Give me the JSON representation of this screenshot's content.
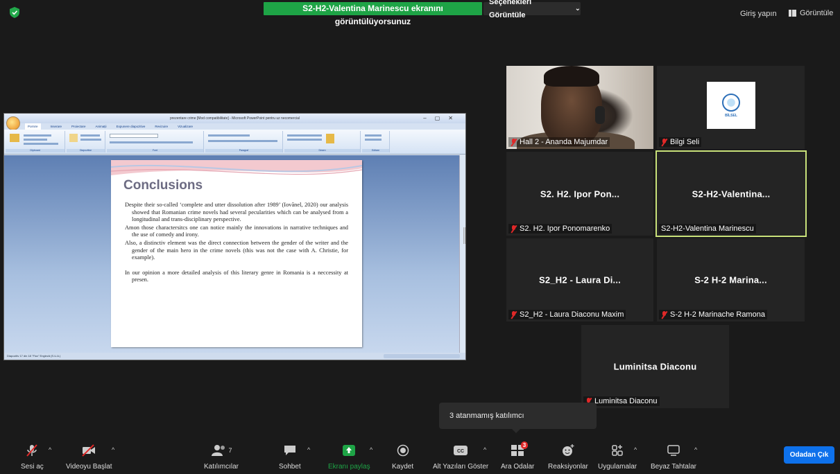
{
  "top": {
    "share_banner": "S2-H2-Valentina Marinescu ekranını görüntülüyorsunuz",
    "view_options": "Seçenekleri Görüntüle",
    "signin": "Giriş yapın",
    "view": "Görüntüle"
  },
  "ppt": {
    "window_title": "prezentare crime [Mod compatibilitate] - Microsoft PowerPoint pentru uz necomercial",
    "tabs": [
      "Pornire",
      "Inserare",
      "Proiectare",
      "Animații",
      "Expunere diapozitive",
      "Revizuire",
      "Vizualizare"
    ],
    "groups": [
      "Clipboard",
      "Diapozitive",
      "Font",
      "Paragraf",
      "Desen",
      "Editare"
    ],
    "status": "Diapozitiv 17 din 18   \"Flux\"   Engleză (S.U.A.)",
    "slide": {
      "title": "Conclusions",
      "paragraphs": [
        "Despite their so-called ‘complete and utter dissolution after 1989’ (Iovănel, 2020) our analysis showed that Romanian crime novels had several pecularities which can be analysed from a longitudinal and trans-disciplinary perspective.",
        "Amon those charactersitcs one can notice mainly the innovations in narrative techniques and the use of comedy and irony.",
        "Also, a distinctiv element was the direct connection between the gender of the writer and the gender of the main hero in the crime novels (this was not the case with A. Christie, for example).",
        "In our opinion a more detailed analysis of this literary genre in Romania is a neccessity at presen."
      ]
    }
  },
  "participants": [
    {
      "label": "Hall 2 - Ananda Majumdar",
      "muted": true,
      "kind": "video"
    },
    {
      "label": "Bilgi Seli",
      "muted": true,
      "kind": "logo",
      "logo_text": "BİLSEL"
    },
    {
      "center": "S2. H2. Ipor Pon...",
      "label": "S2. H2. Ipor Ponomarenko",
      "muted": true
    },
    {
      "center": "S2-H2-Valentina...",
      "label": "S2-H2-Valentina Marinescu",
      "muted": false,
      "active": true
    },
    {
      "center": "S2_H2 - Laura Di...",
      "label": "S2_H2 - Laura Diaconu Maxim",
      "muted": true
    },
    {
      "center": "S-2 H-2   Marina...",
      "label": "S-2 H-2   Marinache Ramona",
      "muted": true
    },
    {
      "center": "Luminitsa Diaconu",
      "label": "Luminitsa Diaconu",
      "muted": true
    }
  ],
  "tooltip": "3 atanmamış katılımcı",
  "toolbar": {
    "unmute": "Sesi aç",
    "start_video": "Videoyu Başlat",
    "participants": "Katılımcılar",
    "participants_count": "7",
    "chat": "Sohbet",
    "share": "Ekranı paylaş",
    "record": "Kaydet",
    "captions": "Alt Yazıları Göster",
    "breakout": "Ara Odalar",
    "breakout_badge": "3",
    "reactions": "Reaksiyonlar",
    "apps": "Uygulamalar",
    "whiteboard": "Beyaz Tahtalar",
    "leave": "Odadan Çık"
  },
  "colors": {
    "share_green": "#1ea446",
    "leave_blue": "#0e71eb",
    "muted_red": "#e02828",
    "active_border": "#c9e27a"
  }
}
